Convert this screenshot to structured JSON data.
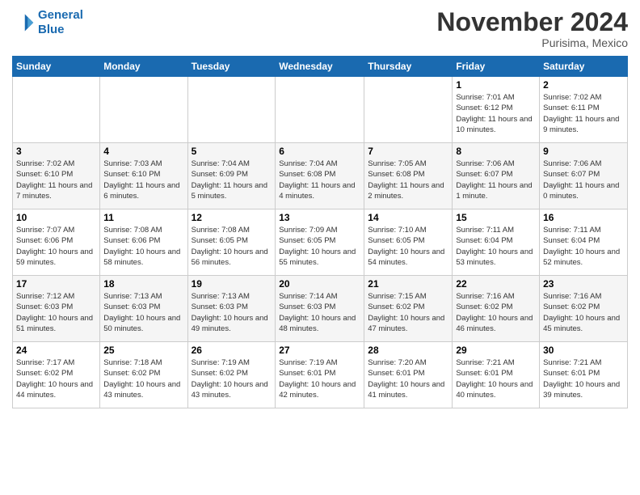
{
  "logo": {
    "line1": "General",
    "line2": "Blue"
  },
  "title": "November 2024",
  "subtitle": "Purisima, Mexico",
  "weekdays": [
    "Sunday",
    "Monday",
    "Tuesday",
    "Wednesday",
    "Thursday",
    "Friday",
    "Saturday"
  ],
  "weeks": [
    [
      {
        "day": "",
        "info": ""
      },
      {
        "day": "",
        "info": ""
      },
      {
        "day": "",
        "info": ""
      },
      {
        "day": "",
        "info": ""
      },
      {
        "day": "",
        "info": ""
      },
      {
        "day": "1",
        "info": "Sunrise: 7:01 AM\nSunset: 6:12 PM\nDaylight: 11 hours and 10 minutes."
      },
      {
        "day": "2",
        "info": "Sunrise: 7:02 AM\nSunset: 6:11 PM\nDaylight: 11 hours and 9 minutes."
      }
    ],
    [
      {
        "day": "3",
        "info": "Sunrise: 7:02 AM\nSunset: 6:10 PM\nDaylight: 11 hours and 7 minutes."
      },
      {
        "day": "4",
        "info": "Sunrise: 7:03 AM\nSunset: 6:10 PM\nDaylight: 11 hours and 6 minutes."
      },
      {
        "day": "5",
        "info": "Sunrise: 7:04 AM\nSunset: 6:09 PM\nDaylight: 11 hours and 5 minutes."
      },
      {
        "day": "6",
        "info": "Sunrise: 7:04 AM\nSunset: 6:08 PM\nDaylight: 11 hours and 4 minutes."
      },
      {
        "day": "7",
        "info": "Sunrise: 7:05 AM\nSunset: 6:08 PM\nDaylight: 11 hours and 2 minutes."
      },
      {
        "day": "8",
        "info": "Sunrise: 7:06 AM\nSunset: 6:07 PM\nDaylight: 11 hours and 1 minute."
      },
      {
        "day": "9",
        "info": "Sunrise: 7:06 AM\nSunset: 6:07 PM\nDaylight: 11 hours and 0 minutes."
      }
    ],
    [
      {
        "day": "10",
        "info": "Sunrise: 7:07 AM\nSunset: 6:06 PM\nDaylight: 10 hours and 59 minutes."
      },
      {
        "day": "11",
        "info": "Sunrise: 7:08 AM\nSunset: 6:06 PM\nDaylight: 10 hours and 58 minutes."
      },
      {
        "day": "12",
        "info": "Sunrise: 7:08 AM\nSunset: 6:05 PM\nDaylight: 10 hours and 56 minutes."
      },
      {
        "day": "13",
        "info": "Sunrise: 7:09 AM\nSunset: 6:05 PM\nDaylight: 10 hours and 55 minutes."
      },
      {
        "day": "14",
        "info": "Sunrise: 7:10 AM\nSunset: 6:05 PM\nDaylight: 10 hours and 54 minutes."
      },
      {
        "day": "15",
        "info": "Sunrise: 7:11 AM\nSunset: 6:04 PM\nDaylight: 10 hours and 53 minutes."
      },
      {
        "day": "16",
        "info": "Sunrise: 7:11 AM\nSunset: 6:04 PM\nDaylight: 10 hours and 52 minutes."
      }
    ],
    [
      {
        "day": "17",
        "info": "Sunrise: 7:12 AM\nSunset: 6:03 PM\nDaylight: 10 hours and 51 minutes."
      },
      {
        "day": "18",
        "info": "Sunrise: 7:13 AM\nSunset: 6:03 PM\nDaylight: 10 hours and 50 minutes."
      },
      {
        "day": "19",
        "info": "Sunrise: 7:13 AM\nSunset: 6:03 PM\nDaylight: 10 hours and 49 minutes."
      },
      {
        "day": "20",
        "info": "Sunrise: 7:14 AM\nSunset: 6:03 PM\nDaylight: 10 hours and 48 minutes."
      },
      {
        "day": "21",
        "info": "Sunrise: 7:15 AM\nSunset: 6:02 PM\nDaylight: 10 hours and 47 minutes."
      },
      {
        "day": "22",
        "info": "Sunrise: 7:16 AM\nSunset: 6:02 PM\nDaylight: 10 hours and 46 minutes."
      },
      {
        "day": "23",
        "info": "Sunrise: 7:16 AM\nSunset: 6:02 PM\nDaylight: 10 hours and 45 minutes."
      }
    ],
    [
      {
        "day": "24",
        "info": "Sunrise: 7:17 AM\nSunset: 6:02 PM\nDaylight: 10 hours and 44 minutes."
      },
      {
        "day": "25",
        "info": "Sunrise: 7:18 AM\nSunset: 6:02 PM\nDaylight: 10 hours and 43 minutes."
      },
      {
        "day": "26",
        "info": "Sunrise: 7:19 AM\nSunset: 6:02 PM\nDaylight: 10 hours and 43 minutes."
      },
      {
        "day": "27",
        "info": "Sunrise: 7:19 AM\nSunset: 6:01 PM\nDaylight: 10 hours and 42 minutes."
      },
      {
        "day": "28",
        "info": "Sunrise: 7:20 AM\nSunset: 6:01 PM\nDaylight: 10 hours and 41 minutes."
      },
      {
        "day": "29",
        "info": "Sunrise: 7:21 AM\nSunset: 6:01 PM\nDaylight: 10 hours and 40 minutes."
      },
      {
        "day": "30",
        "info": "Sunrise: 7:21 AM\nSunset: 6:01 PM\nDaylight: 10 hours and 39 minutes."
      }
    ]
  ]
}
